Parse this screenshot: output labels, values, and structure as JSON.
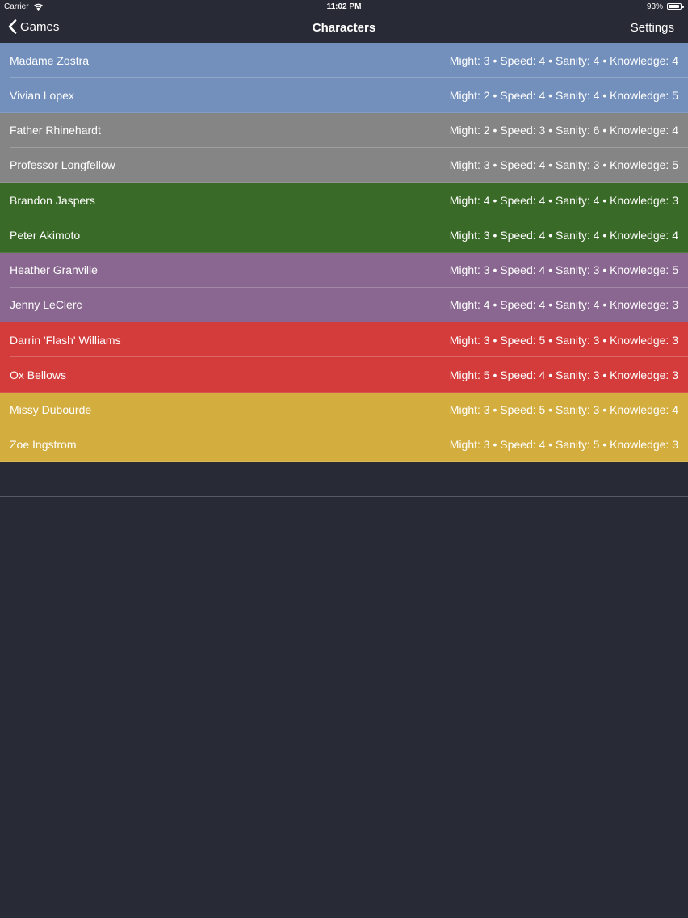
{
  "status_bar": {
    "carrier": "Carrier",
    "time": "11:02 PM",
    "battery": "93%",
    "battery_level": 0.93
  },
  "nav": {
    "back_label": "Games",
    "title": "Characters",
    "settings_label": "Settings"
  },
  "colors": {
    "background": "#282a35",
    "blue": "#7390bd",
    "gray": "#858585",
    "green": "#3a6a27",
    "purple": "#8a6790",
    "red": "#d43c3c",
    "yellow": "#d3ad3e"
  },
  "characters": [
    {
      "name": "Madame Zostra",
      "stats": "Might: 3 • Speed: 4 • Sanity: 4 • Knowledge: 4",
      "color": "blue"
    },
    {
      "name": "Vivian Lopex",
      "stats": "Might: 2 • Speed: 4 • Sanity: 4 • Knowledge: 5",
      "color": "blue"
    },
    {
      "name": "Father Rhinehardt",
      "stats": "Might: 2 • Speed: 3 • Sanity: 6 • Knowledge: 4",
      "color": "gray"
    },
    {
      "name": "Professor Longfellow",
      "stats": "Might: 3 • Speed: 4 • Sanity: 3 • Knowledge: 5",
      "color": "gray"
    },
    {
      "name": "Brandon Jaspers",
      "stats": "Might: 4 • Speed: 4 • Sanity: 4 • Knowledge: 3",
      "color": "green"
    },
    {
      "name": "Peter Akimoto",
      "stats": "Might: 3 • Speed: 4 • Sanity: 4 • Knowledge: 4",
      "color": "green"
    },
    {
      "name": "Heather Granville",
      "stats": "Might: 3 • Speed: 4 • Sanity: 3 • Knowledge: 5",
      "color": "purple"
    },
    {
      "name": "Jenny LeClerc",
      "stats": "Might: 4 • Speed: 4 • Sanity: 4 • Knowledge: 3",
      "color": "purple"
    },
    {
      "name": "Darrin 'Flash' Williams",
      "stats": "Might: 3 • Speed: 5 • Sanity: 3 • Knowledge: 3",
      "color": "red"
    },
    {
      "name": "Ox Bellows",
      "stats": "Might: 5 • Speed: 4 • Sanity: 3 • Knowledge: 3",
      "color": "red"
    },
    {
      "name": "Missy Dubourde",
      "stats": "Might: 3 • Speed: 5 • Sanity: 3 • Knowledge: 4",
      "color": "yellow"
    },
    {
      "name": "Zoe Ingstrom",
      "stats": "Might: 3 • Speed: 4 • Sanity: 5 • Knowledge: 3",
      "color": "yellow"
    }
  ]
}
